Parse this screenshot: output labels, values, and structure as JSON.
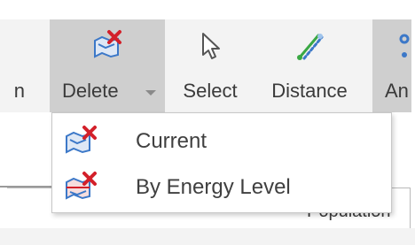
{
  "ribbon": {
    "prev_label_fragment": "n",
    "delete_label": "Delete",
    "select_label": "Select",
    "distance_label": "Distance",
    "next_label_fragment": "An"
  },
  "delete_menu": {
    "items": [
      {
        "label": "Current",
        "icon": "delete-current-icon"
      },
      {
        "label": "By Energy Level",
        "icon": "delete-by-energy-level-icon"
      }
    ]
  },
  "panel": {
    "text_fragment": "Population"
  },
  "colors": {
    "ribbon_bg": "#f3f3f3",
    "pressed_bg": "#cfcfcf",
    "delete_x_red": "#d3202a",
    "icon_blue": "#3c78c8",
    "distance_green": "#3aa844"
  }
}
